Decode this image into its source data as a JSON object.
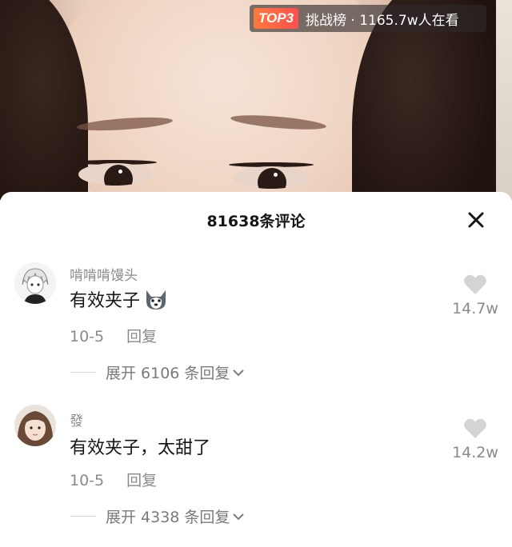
{
  "live_badge": {
    "rank_label": "TOP3",
    "text": "挑战榜 · 1165.7w人在看"
  },
  "sheet": {
    "title": "81638条评论"
  },
  "comments": [
    {
      "username": "啃啃啃馒头",
      "text": "有效夹子",
      "emoji": "husky-emoji",
      "date": "10-5",
      "reply_label": "回复",
      "likes": "14.7w",
      "expand_label": "展开 6106 条回复"
    },
    {
      "username": "發",
      "text": "有效夹子，太甜了",
      "date": "10-5",
      "reply_label": "回复",
      "likes": "14.2w",
      "expand_label": "展开 4338 条回复"
    }
  ]
}
